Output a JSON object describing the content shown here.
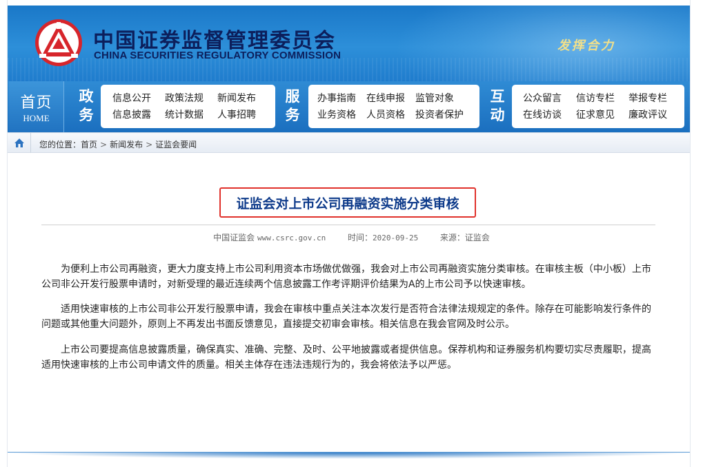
{
  "header": {
    "cn_title": "中国证券监督管理委员会",
    "en_title": "CHINA SECURITIES REGULATORY COMMISSION",
    "slogan": "发挥合力",
    "colors": {
      "banner": "#1a78c8",
      "title": "#0c1f5c",
      "slogan": "#f2e08a",
      "logo_red": "#d7252b"
    }
  },
  "nav": {
    "home_cn": "首页",
    "home_en": "HOME",
    "sections": [
      {
        "label": [
          "政",
          "务"
        ],
        "items": [
          "信息公开",
          "政策法规",
          "新闻发布",
          "信息披露",
          "统计数据",
          "人事招聘"
        ]
      },
      {
        "label": [
          "服",
          "务"
        ],
        "items": [
          "办事指南",
          "在线申报",
          "监管对象",
          "业务资格",
          "人员资格",
          "投资者保护"
        ]
      },
      {
        "label": [
          "互",
          "动"
        ],
        "items": [
          "公众留言",
          "信访专栏",
          "举报专栏",
          "在线访谈",
          "征求意见",
          "廉政评议"
        ]
      }
    ]
  },
  "breadcrumb": {
    "home_icon": "house-icon",
    "prefix": "您的位置：",
    "items": [
      "首页",
      "新闻发布",
      "证监会要闻"
    ],
    "separator": ">"
  },
  "article": {
    "title": "证监会对上市公司再融资实施分类审核",
    "title_border_color": "#e0302a",
    "meta": {
      "site": "中国证监会",
      "url": "www.csrc.gov.cn",
      "time_label": "时间：",
      "time": "2020-09-25",
      "source_label": "来源：",
      "source": "证监会"
    },
    "paragraphs": [
      "为便利上市公司再融资，更大力度支持上市公司利用资本市场做优做强，我会对上市公司再融资实施分类审核。在审核主板（中小板）上市公司非公开发行股票申请时，对新受理的最近连续两个信息披露工作考评期评价结果为A的上市公司予以快速审核。",
      "适用快速审核的上市公司非公开发行股票申请，我会在审核中重点关注本次发行是否符合法律法规规定的条件。除存在可能影响发行条件的问题或其他重大问题外，原则上不再发出书面反馈意见，直接提交初审会审核。相关信息在我会官网及时公示。",
      "上市公司要提高信息披露质量，确保真实、准确、完整、及时、公平地披露或者提供信息。保荐机构和证券服务机构要切实尽责履职，提高适用快速审核的上市公司申请文件的质量。相关主体存在违法违规行为的，我会将依法予以严惩。"
    ]
  }
}
